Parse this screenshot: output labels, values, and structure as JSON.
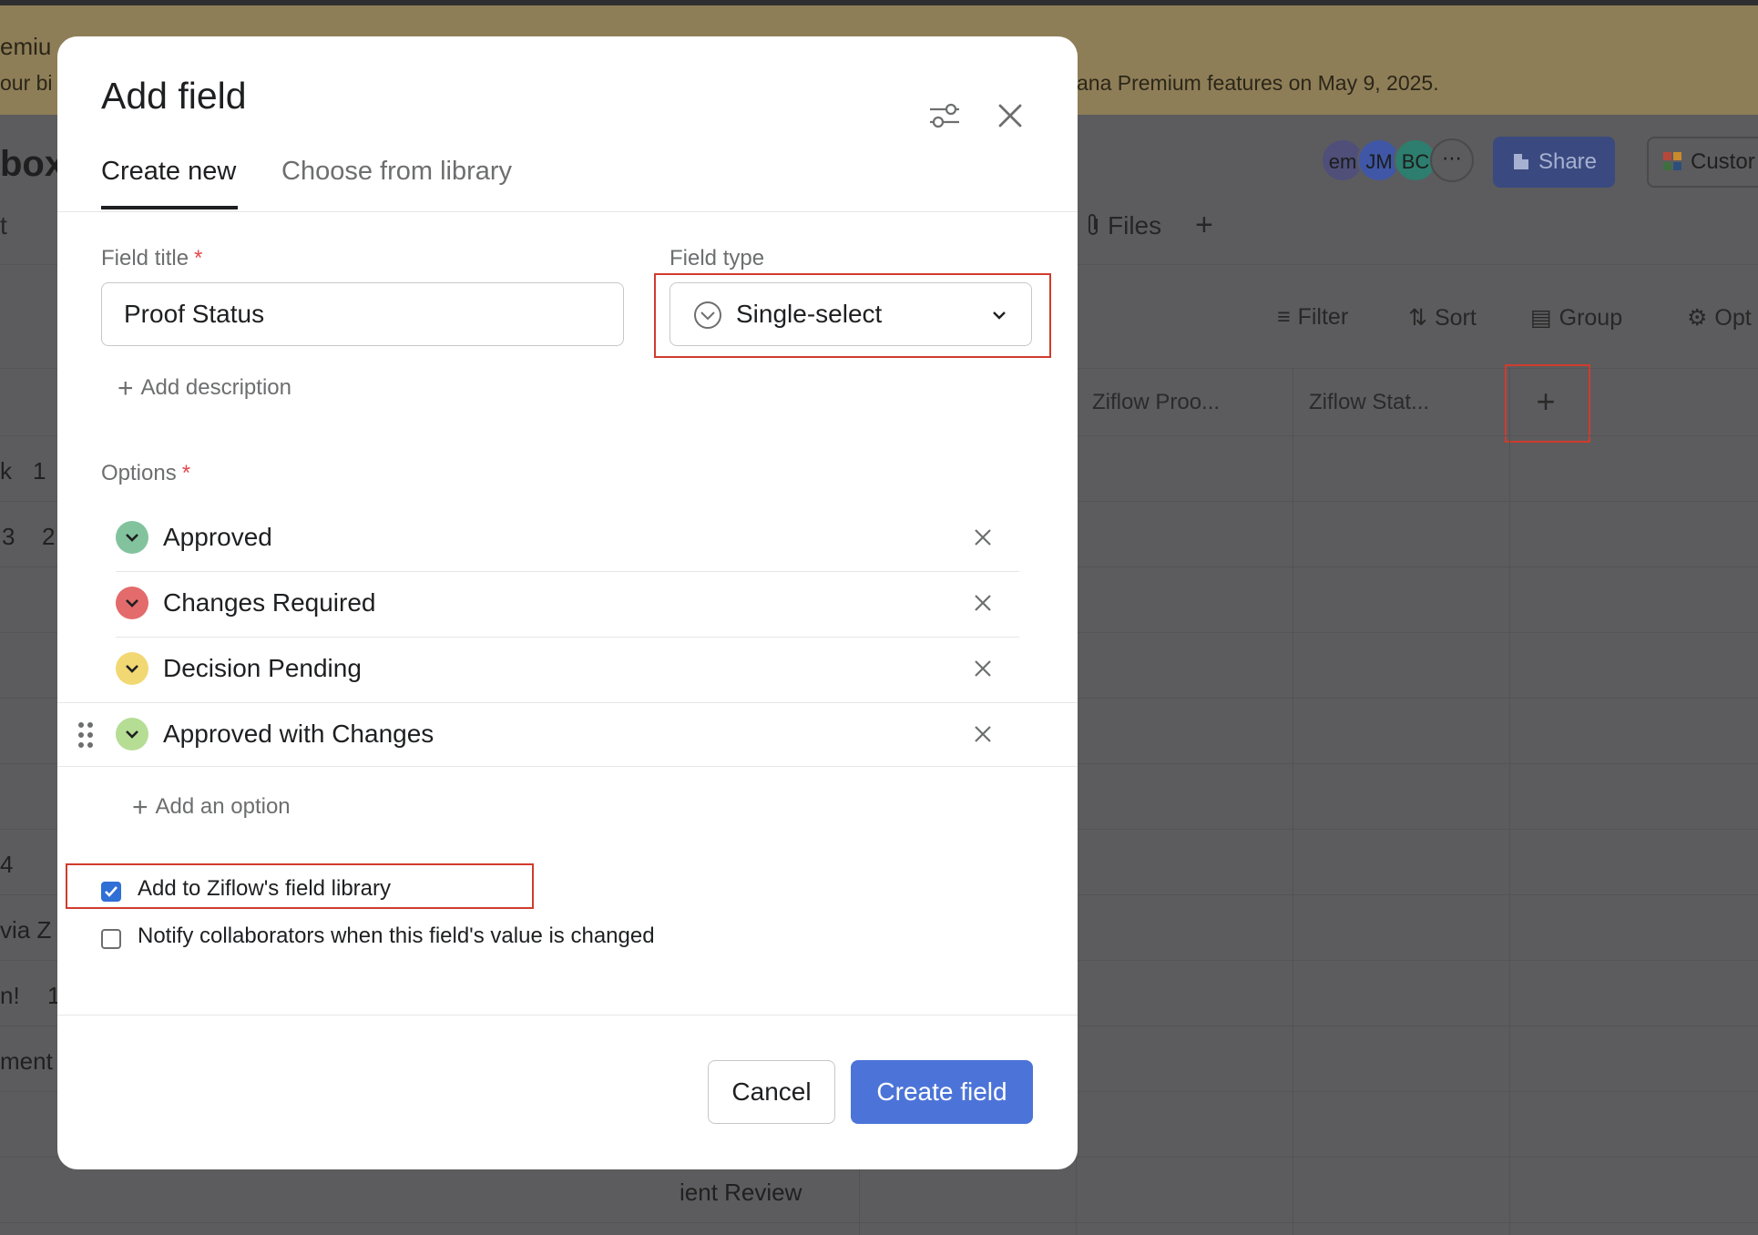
{
  "background": {
    "banner_line1": "emiu",
    "banner_line2": "our bi",
    "banner_right": "ana Premium features on May 9, 2025.",
    "project_title": "box",
    "avatars": [
      "em",
      "JM",
      "BC"
    ],
    "share_label": "Share",
    "customize_label": "Custor",
    "tabs": {
      "t_label": "t",
      "files": "Files"
    },
    "toolbar": {
      "filter": "Filter",
      "sort": "Sort",
      "group": "Group",
      "options": "Opt"
    },
    "columns": {
      "proof": "Ziflow Proo...",
      "status": "Ziflow Stat..."
    },
    "cells": [
      "k",
      "1",
      "3",
      "2",
      "4",
      "via Z",
      "n!",
      "1",
      "ment",
      "ient Review"
    ]
  },
  "modal": {
    "title": "Add field",
    "tabs": [
      {
        "label": "Create new",
        "active": true
      },
      {
        "label": "Choose from library",
        "active": false
      }
    ],
    "field_title": {
      "label": "Field title",
      "required_mark": "*",
      "value": "Proof Status"
    },
    "field_type": {
      "label": "Field type",
      "value": "Single-select"
    },
    "add_description": "Add description",
    "options": {
      "label": "Options",
      "required_mark": "*",
      "items": [
        {
          "label": "Approved",
          "color": "#82c39d"
        },
        {
          "label": "Changes Required",
          "color": "#e36b6b"
        },
        {
          "label": "Decision Pending",
          "color": "#f2d873"
        },
        {
          "label": "Approved with Changes",
          "color": "#b6dd94"
        }
      ],
      "add_option": "Add an option"
    },
    "checkboxes": [
      {
        "label": "Add to Ziflow's field library",
        "checked": true
      },
      {
        "label": "Notify collaborators when this field's value is changed",
        "checked": false
      }
    ],
    "cancel_label": "Cancel",
    "create_label": "Create field"
  },
  "colors": {
    "primary": "#4c74d8",
    "highlight": "#d13b2e",
    "checkbox": "#2f6fd6"
  },
  "icons": [
    "settings-sliders-icon",
    "close-icon",
    "single-select-icon",
    "chevron-down-icon",
    "plus-icon",
    "remove-x-icon",
    "drag-handle-icon",
    "checkbox-icon"
  ]
}
